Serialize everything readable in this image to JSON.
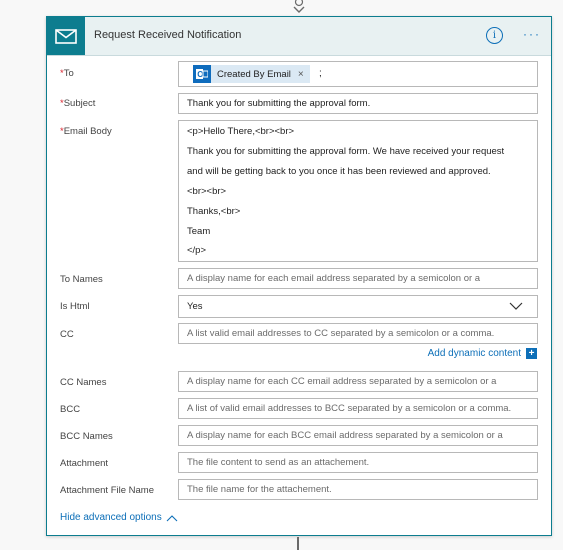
{
  "card": {
    "title": "Request Received Notification",
    "info_glyph": "i",
    "more_glyph": "···"
  },
  "fields": {
    "to": {
      "label": "To",
      "token": "Created By Email",
      "token_remove": "×",
      "separator": ";"
    },
    "subject": {
      "label": "Subject",
      "value": "Thank you for submitting the approval form."
    },
    "email_body": {
      "label": "Email Body",
      "lines": [
        "<p>Hello There,<br><br>",
        "Thank you for submitting the approval form. We have received your request",
        "and will be getting back to you once it has been reviewed and approved.",
        "<br><br>",
        "Thanks,<br>",
        "Team",
        "</p>"
      ]
    },
    "to_names": {
      "label": "To Names",
      "placeholder": "A display name for each email address separated by a semicolon or a"
    },
    "is_html": {
      "label": "Is Html",
      "value": "Yes"
    },
    "cc": {
      "label": "CC",
      "placeholder": "A list valid email addresses to CC separated by a semicolon or a comma."
    },
    "cc_names": {
      "label": "CC Names",
      "placeholder": "A display name for each CC email address separated by a semicolon or a"
    },
    "bcc": {
      "label": "BCC",
      "placeholder": "A list of valid email addresses to BCC separated by a semicolon or a comma."
    },
    "bcc_names": {
      "label": "BCC Names",
      "placeholder": "A display name for each BCC email address separated by a semicolon or a"
    },
    "attachment": {
      "label": "Attachment",
      "placeholder": "The file content to send as an attachement."
    },
    "attachment_file_name": {
      "label": "Attachment File Name",
      "placeholder": "The file name for the attachement."
    }
  },
  "required_marker": "*",
  "dynamic_content": {
    "label": "Add dynamic content",
    "plus_glyph": "+"
  },
  "advanced": {
    "label": "Hide advanced options"
  },
  "colors": {
    "accent": "#0d7d8f",
    "link": "#0d6fb8",
    "required": "#d9232e"
  }
}
